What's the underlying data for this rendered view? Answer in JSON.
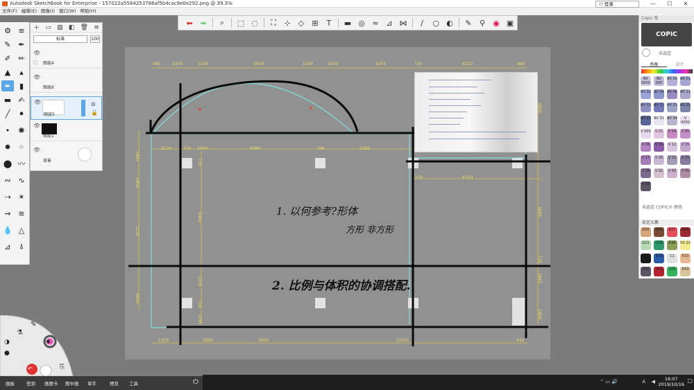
{
  "window": {
    "title": "Autodesk SketchBook for Enterprise - 157022a5584253786af5b4cac9e0e292.png @ 39.3%",
    "minimize": "—",
    "maximize": "☐",
    "close": "✕"
  },
  "menu": [
    "文件(F)",
    "编辑(E)",
    "图像(I)",
    "窗口(W)",
    "帮助(H)"
  ],
  "account": {
    "login_label": "登录"
  },
  "layers": {
    "blend_mode": "标准",
    "opacity": "100",
    "items": [
      {
        "name": "图层4"
      },
      {
        "name": "图层6"
      },
      {
        "name": "图层5"
      },
      {
        "name": "图层1"
      },
      {
        "name": "背景"
      }
    ]
  },
  "copic": {
    "header": "Copic 库",
    "logo": "COPIC",
    "unselected": "未选定",
    "tabs": [
      "色板",
      "设计"
    ],
    "unselected_marker": "未选定 COPIC® 颜色",
    "custom_set": "自定义集",
    "library_swatches": [
      {
        "code": "BV 0000",
        "color": "#c8c4dc"
      },
      {
        "code": "BV 000",
        "color": "#bcb8d8"
      },
      {
        "code": "BV 00",
        "color": "#b2b0d6"
      },
      {
        "code": "BV 01",
        "color": "#a5a6d0"
      },
      {
        "code": "BV 02",
        "color": "#9ba6d6"
      },
      {
        "code": "BV 04",
        "color": "#8e97cc"
      },
      {
        "code": "BV 08",
        "color": "#9b89c2"
      },
      {
        "code": "BV 11",
        "color": "#a8a7c8"
      },
      {
        "code": "BV 13",
        "color": "#8d8fc0"
      },
      {
        "code": "BV 17",
        "color": "#7279b8"
      },
      {
        "code": "BV 23",
        "color": "#9aa4c7"
      },
      {
        "code": "BV 25",
        "color": "#7985ad"
      },
      {
        "code": "BV 29",
        "color": "#5b6596"
      },
      {
        "code": "BV 31",
        "color": "#e7e4ef"
      },
      {
        "code": "BV 34",
        "color": "#b6b5cb"
      },
      {
        "code": "V 0000",
        "color": "#eadff0"
      },
      {
        "code": "V 000",
        "color": "#e6d8ec"
      },
      {
        "code": "V 01",
        "color": "#e3c4e0"
      },
      {
        "code": "V 04",
        "color": "#c889c0"
      },
      {
        "code": "V 05",
        "color": "#c490c8"
      },
      {
        "code": "V 06",
        "color": "#b282c0"
      },
      {
        "code": "V 09",
        "color": "#8a5ba8"
      },
      {
        "code": "V 12",
        "color": "#d8c4de"
      },
      {
        "code": "V 15",
        "color": "#c5a6d0"
      },
      {
        "code": "V 17",
        "color": "#a47db8"
      },
      {
        "code": "V 20",
        "color": "#c7b7d2"
      },
      {
        "code": "V 22",
        "color": "#a79cb5"
      },
      {
        "code": "V 25",
        "color": "#877ca0"
      },
      {
        "code": "V 28",
        "color": "#7e6a8e"
      },
      {
        "code": "V 91",
        "color": "#d5bfcf"
      },
      {
        "code": "V 93",
        "color": "#cdb0cb"
      },
      {
        "code": "V 95",
        "color": "#b18ca7"
      },
      {
        "code": "V 99",
        "color": "#5d5465"
      }
    ],
    "custom_swatches": [
      {
        "code": "E35",
        "color": "#d5a47d"
      },
      {
        "code": "E49",
        "color": "#7a4a33"
      },
      {
        "code": "R37",
        "color": "#e54d5c"
      },
      {
        "code": "R89",
        "color": "#9b2731"
      },
      {
        "code": "G21",
        "color": "#b8d8b6"
      },
      {
        "code": "G29",
        "color": "#2c9a6a"
      },
      {
        "code": "G99",
        "color": "#8a9e58"
      },
      {
        "code": "YG 21",
        "color": "#f2ea8e"
      },
      {
        "code": "110",
        "color": "#1a1a1a"
      },
      {
        "code": "B39",
        "color": "#2a5ca8"
      },
      {
        "code": "C1",
        "color": "#dfe2e3"
      },
      {
        "code": "E33",
        "color": "#e9b892"
      },
      {
        "code": "V99",
        "color": "#5d5465"
      },
      {
        "code": "R59",
        "color": "#b4242f"
      },
      {
        "code": "G05",
        "color": "#35b55e"
      },
      {
        "code": "E43",
        "color": "#d8c49a"
      }
    ]
  },
  "drawing": {
    "top_dims": [
      "480",
      "2340",
      "1200",
      "5920",
      "1200",
      "2340",
      "4205",
      "720",
      "6220",
      "886"
    ],
    "mid_dims": [
      "2130",
      "710",
      "1000",
      "8085",
      "700",
      "5595"
    ],
    "right_mid_dims": [
      "150",
      "6220"
    ],
    "bottom_dims": [
      "1320",
      "3865",
      "3600",
      "15040",
      "940"
    ],
    "left_dims": [
      "2495",
      "1450",
      "5130",
      "4450"
    ],
    "vertical_mid_dims": [
      "710",
      "6480",
      "2235",
      "710",
      "1195"
    ],
    "right_dims": [
      "3850",
      "5695",
      "720",
      "2845",
      "1800"
    ],
    "note_1": "1. 以何参考?形体",
    "note_1b": "方形    非方形",
    "note_2": "2. 比例与体积的协调搭配."
  },
  "app_bar": [
    "画板",
    "签到",
    "画图卡",
    "图中画",
    "草手",
    "预览",
    "工具"
  ],
  "clock": {
    "time": "16:07",
    "date": "2019/10/16"
  },
  "tray": {
    "lang": "A",
    "sound": "◀"
  }
}
